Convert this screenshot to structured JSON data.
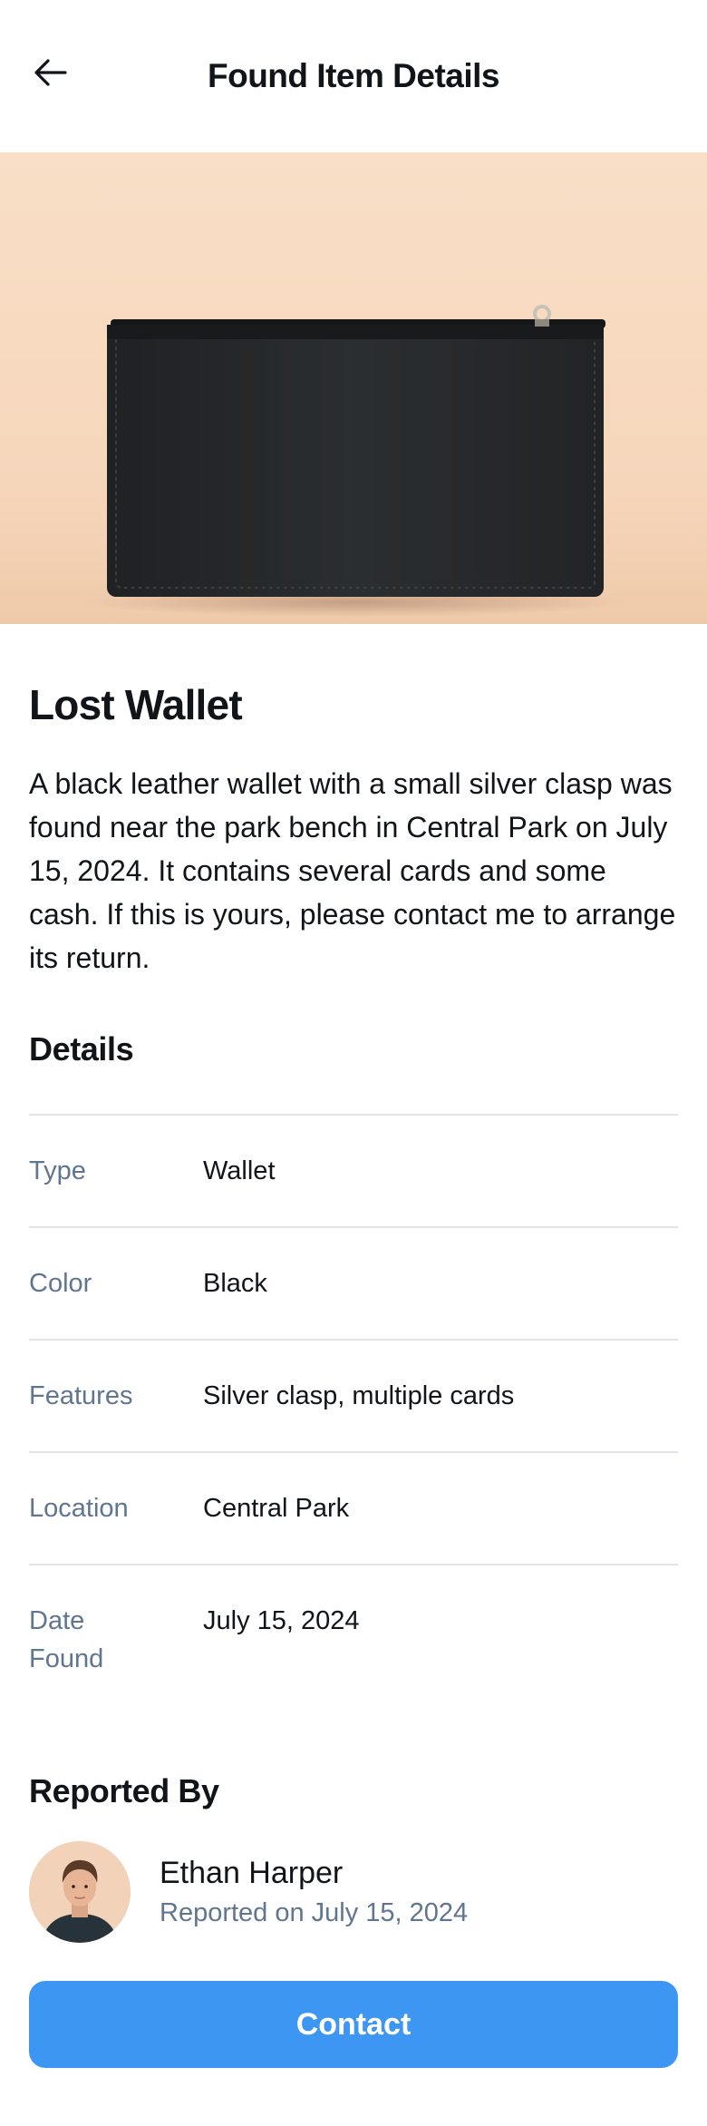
{
  "header": {
    "title": "Found Item Details",
    "back_icon": "arrow-left-icon"
  },
  "item": {
    "title": "Lost Wallet",
    "description": "A black leather wallet with a small silver clasp was found near the park bench in Central Park on July 15, 2024. It contains several cards and some cash. If this is yours, please contact me to arrange its return."
  },
  "details": {
    "title": "Details",
    "rows": [
      {
        "label": "Type",
        "value": "Wallet"
      },
      {
        "label": "Color",
        "value": "Black"
      },
      {
        "label": "Features",
        "value": "Silver clasp, multiple cards"
      },
      {
        "label": "Location",
        "value": "Central Park"
      },
      {
        "label": "Date Found",
        "value": "July 15, 2024"
      }
    ]
  },
  "reporter": {
    "section_title": "Reported By",
    "name": "Ethan Harper",
    "reported_on": "Reported on July 15, 2024"
  },
  "actions": {
    "contact_label": "Contact"
  },
  "colors": {
    "accent": "#3d97f2",
    "muted_text": "#5f7590",
    "hero_background": "#f8dcc3"
  }
}
